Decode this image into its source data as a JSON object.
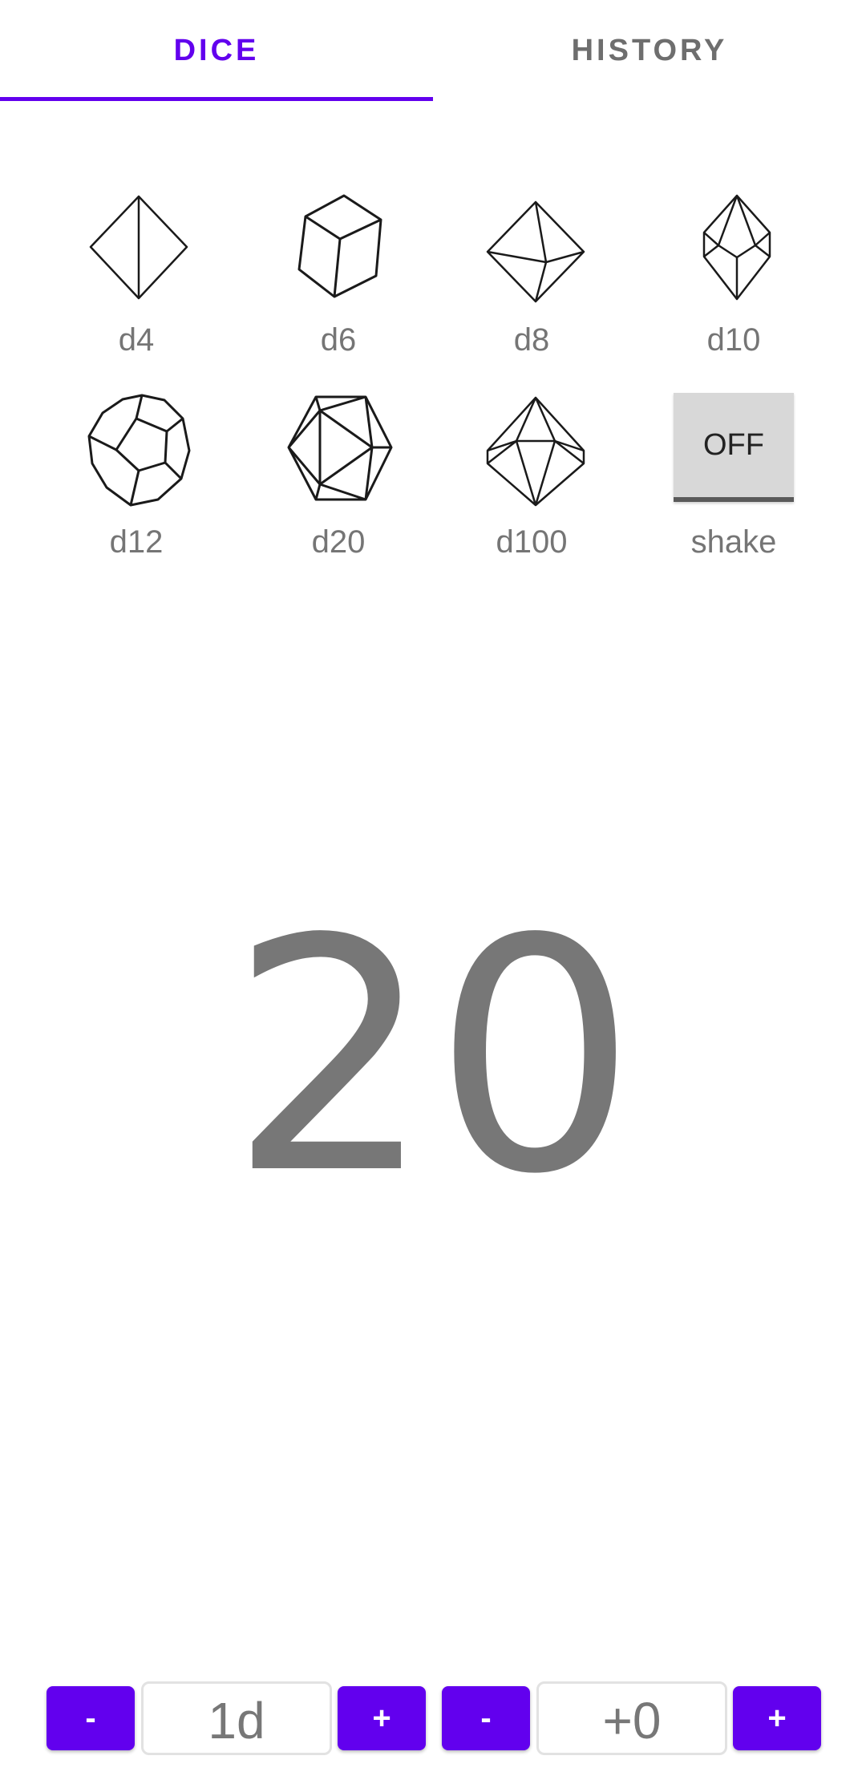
{
  "tabs": {
    "dice": "DICE",
    "history": "HISTORY",
    "active": "dice"
  },
  "dice": [
    {
      "id": "d4",
      "label": "d4",
      "icon": "d4-tetrahedron-icon"
    },
    {
      "id": "d6",
      "label": "d6",
      "icon": "d6-cube-icon"
    },
    {
      "id": "d8",
      "label": "d8",
      "icon": "d8-octahedron-icon"
    },
    {
      "id": "d10",
      "label": "d10",
      "icon": "d10-trapezohedron-icon"
    },
    {
      "id": "d12",
      "label": "d12",
      "icon": "d12-dodecahedron-icon"
    },
    {
      "id": "d20",
      "label": "d20",
      "icon": "d20-icosahedron-icon"
    },
    {
      "id": "d100",
      "label": "d100",
      "icon": "d100-die-icon"
    }
  ],
  "shake": {
    "label": "shake",
    "state": "OFF"
  },
  "result": "20",
  "controls": {
    "dice_count_minus": "-",
    "dice_count": "1d",
    "dice_count_plus": "+",
    "modifier_minus": "-",
    "modifier": "+0",
    "modifier_plus": "+"
  },
  "colors": {
    "accent": "#6200ee",
    "text_gray": "#757575",
    "result_gray": "#777777",
    "toggle_bg": "#d8d8d8"
  }
}
